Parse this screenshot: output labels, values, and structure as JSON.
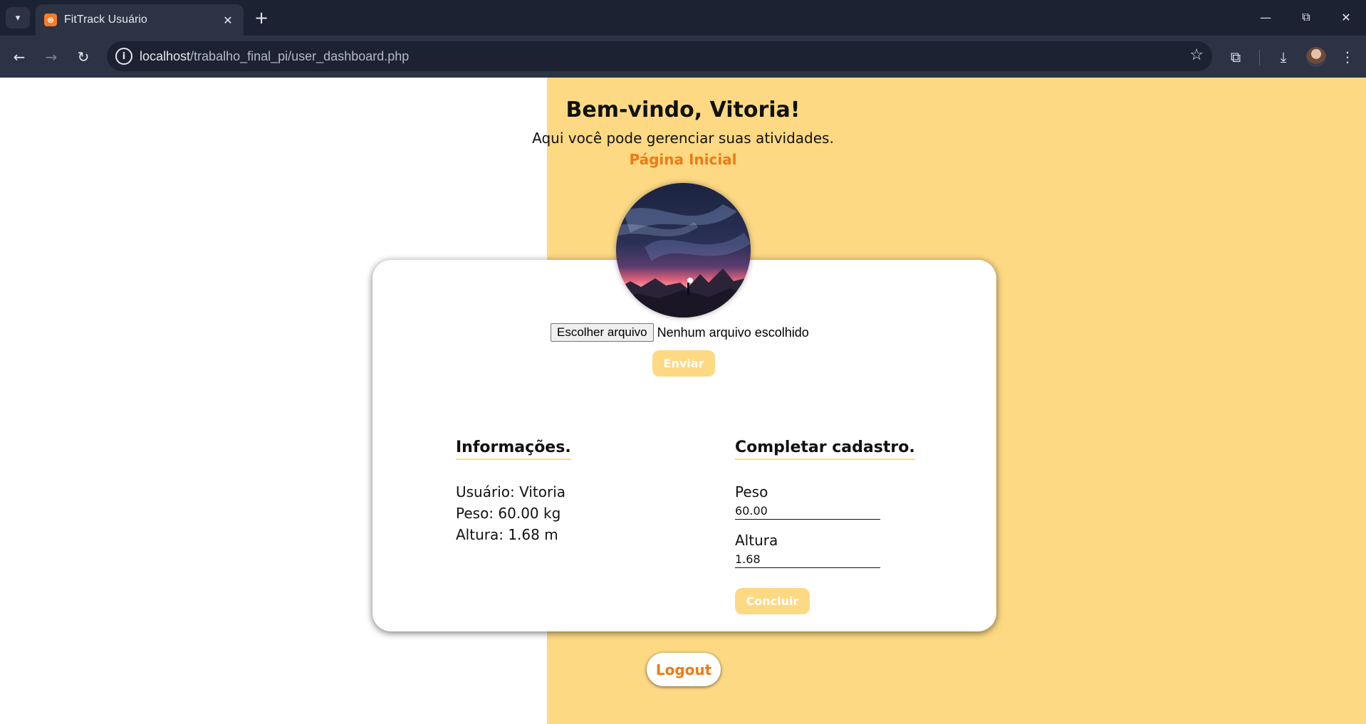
{
  "browser": {
    "tab": {
      "title": "FitTrack Usuário",
      "favicon": "xampp-icon"
    },
    "url": {
      "host": "localhost",
      "path": "/trabalho_final_pi/user_dashboard.php"
    }
  },
  "page": {
    "welcome": "Bem-vindo, Vitoria!",
    "subtitle": "Aqui você pode gerenciar suas atividades.",
    "home_link": "Página Inicial"
  },
  "upload": {
    "choose_button": "Escolher arquivo",
    "status": "Nenhum arquivo escolhido",
    "submit_label": "Enviar"
  },
  "info": {
    "title": "Informações.",
    "lines": [
      "Usuário: Vitoria",
      "Peso: 60.00 kg",
      "Altura: 1.68 m"
    ]
  },
  "complete": {
    "title": "Completar cadastro.",
    "weight_label": "Peso",
    "weight_value": "60.00",
    "height_label": "Altura",
    "height_value": "1.68",
    "submit_label": "Concluir"
  },
  "logout_label": "Logout",
  "colors": {
    "accent_yellow": "#fdd983",
    "accent_orange": "#f07a14",
    "chrome_dark": "#1c2231",
    "chrome_toolbar": "#2b3344"
  }
}
